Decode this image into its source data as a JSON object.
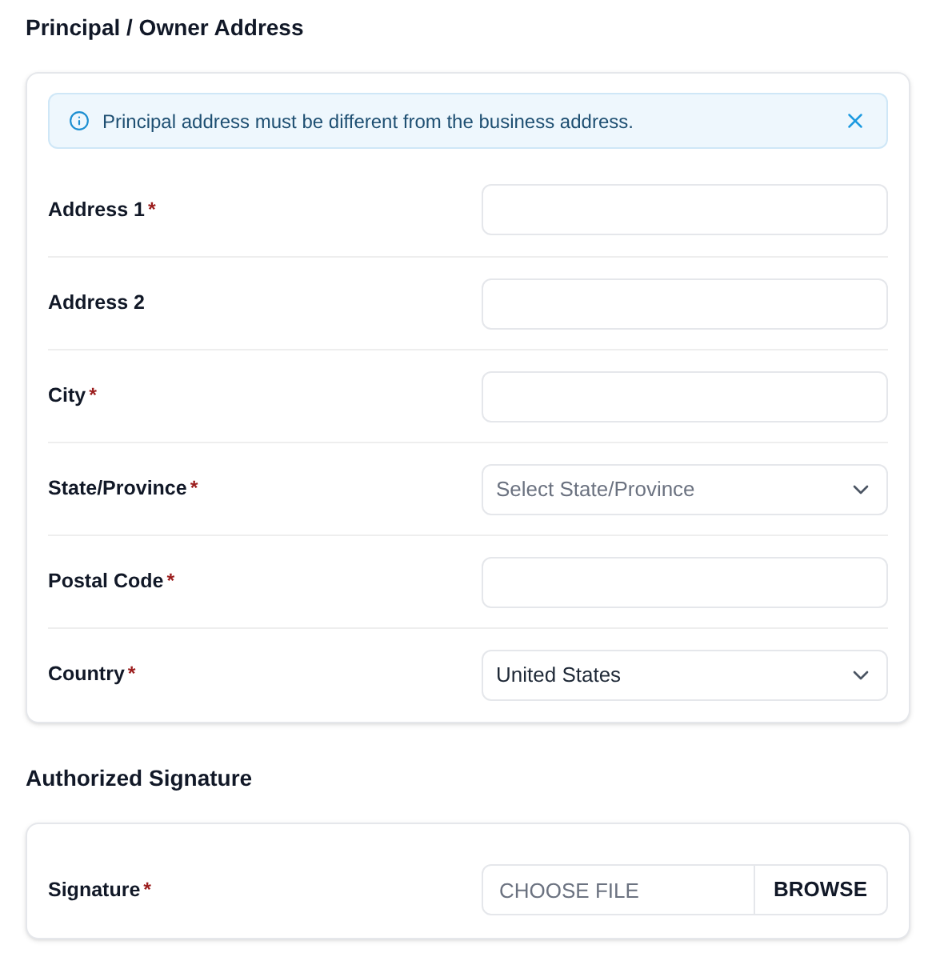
{
  "sections": [
    {
      "title": "Principal / Owner Address",
      "alert": {
        "text": "Principal address must be different from the business address."
      },
      "fields": [
        {
          "label": "Address 1",
          "required": true,
          "kind": "text"
        },
        {
          "label": "Address 2",
          "required": false,
          "kind": "text"
        },
        {
          "label": "City",
          "required": true,
          "kind": "text"
        },
        {
          "label": "State/Province",
          "required": true,
          "kind": "select",
          "placeholder": "Select State/Province"
        },
        {
          "label": "Postal Code",
          "required": true,
          "kind": "text"
        },
        {
          "label": "Country",
          "required": true,
          "kind": "select",
          "value": "United States"
        }
      ]
    },
    {
      "title": "Authorized Signature",
      "fields": [
        {
          "label": "Signature",
          "required": true,
          "kind": "file",
          "placeholder": "CHOOSE FILE",
          "button": "BROWSE"
        }
      ]
    }
  ],
  "required_mark": "*"
}
